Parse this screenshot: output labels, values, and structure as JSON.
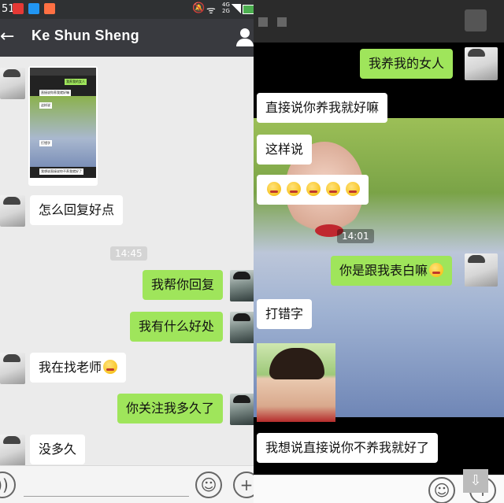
{
  "left": {
    "status": {
      "time": "51",
      "net_top": "4G",
      "net_bottom": "2G"
    },
    "header": {
      "title": "Ke  Shun Sheng"
    },
    "messages": {
      "m1": "怎么回复好点",
      "ts": "14:45",
      "m2": "我帮你回复",
      "m3": "我有什么好处",
      "m4": "我在找老师",
      "m5": "你关注我多久了",
      "m6": "没多久"
    },
    "thumb": {
      "lines": [
        "我养我的女人",
        "直接说你养我就好嘛",
        "这样说",
        "打错字",
        "我想说直接说你不养我就好了"
      ]
    }
  },
  "right": {
    "messages": {
      "r1": "我养我的女人",
      "r2": "直接说你养我就好嘛",
      "r3": "这样说",
      "ts": "14:01",
      "r4": "你是跟我表白嘛",
      "r5": "打错字",
      "r6": "我想说直接说你不养我就好了"
    }
  },
  "colors": {
    "header": "#393a3f",
    "green_bubble": "#9fe55b",
    "white_bubble": "#ffffff",
    "chat_bg": "#ebebeb"
  }
}
